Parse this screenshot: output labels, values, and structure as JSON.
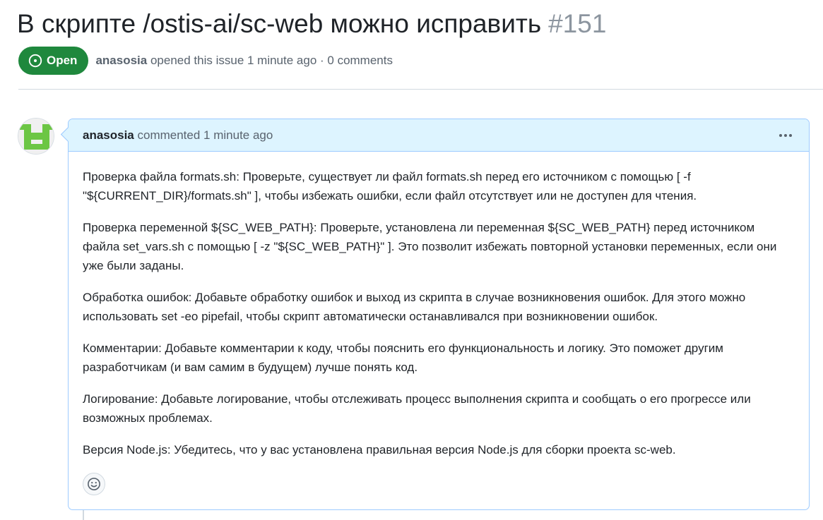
{
  "issue": {
    "title": "В скрипте /ostis-ai/sc-web можно исправить",
    "number": "#151",
    "state": "Open",
    "author": "anasosia",
    "meta_text": "opened this issue 1 minute ago · 0 comments"
  },
  "comment": {
    "author": "anasosia",
    "meta_text": "commented 1 minute ago",
    "paragraphs": [
      "Проверка файла formats.sh: Проверьте, существует ли файл formats.sh перед его источником с помощью [ -f \"${CURRENT_DIR}/formats.sh\" ], чтобы избежать ошибки, если файл отсутствует или не доступен для чтения.",
      "Проверка переменной ${SC_WEB_PATH}: Проверьте, установлена ли переменная ${SC_WEB_PATH} перед источником файла set_vars.sh с помощью [ -z \"${SC_WEB_PATH}\" ]. Это позволит избежать повторной установки переменных, если они уже были заданы.",
      "Обработка ошибок: Добавьте обработку ошибок и выход из скрипта в случае возникновения ошибок. Для этого можно использовать set -eo pipefail, чтобы скрипт автоматически останавливался при возникновении ошибок.",
      "Комментарии: Добавьте комментарии к коду, чтобы пояснить его функциональность и логику. Это поможет другим разработчикам (и вам самим в будущем) лучше понять код.",
      "Логирование: Добавьте логирование, чтобы отслеживать процесс выполнения скрипта и сообщать о его прогрессе или возможных проблемах.",
      "Версия Node.js: Убедитесь, что у вас установлена правильная версия Node.js для сборки проекта sc-web."
    ]
  },
  "icons": {
    "state": "issue-opened-icon",
    "menu": "kebab-horizontal-icon",
    "reaction": "smiley-icon"
  },
  "colors": {
    "open_green": "#1f883d",
    "header_blue": "#ddf4ff",
    "border_blue": "#9ecbff",
    "avatar_green": "#6cc644"
  }
}
